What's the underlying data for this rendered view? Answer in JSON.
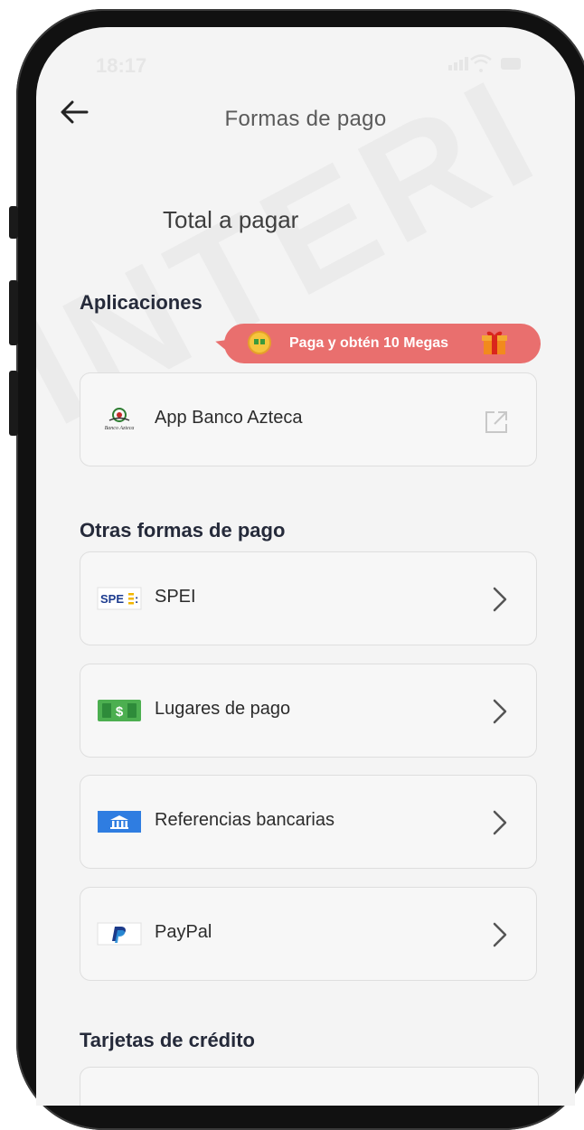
{
  "status_bar": {
    "time": "18:17",
    "icons": "signal-wifi-battery"
  },
  "header": {
    "title": "Formas de pago",
    "back_icon": "arrow-left-icon"
  },
  "total": {
    "label": "Total a pagar"
  },
  "apps_section": {
    "title": "Aplicaciones",
    "promo": {
      "text": "Paga y obtén 10 Megas",
      "color": "#e96f6e"
    },
    "items": [
      {
        "label": "App Banco Azteca",
        "icon": "banco-azteca-logo",
        "action_icon": "external-link-icon"
      }
    ]
  },
  "other_section": {
    "title": "Otras formas de pago",
    "items": [
      {
        "label": "SPEI",
        "icon": "spei-logo"
      },
      {
        "label": "Lugares de pago",
        "icon": "cash-icon"
      },
      {
        "label": "Referencias bancarias",
        "icon": "bank-icon"
      },
      {
        "label": "PayPal",
        "icon": "paypal-icon"
      }
    ]
  },
  "cards_section": {
    "title": "Tarjetas de crédito"
  },
  "watermark": "INTERI"
}
